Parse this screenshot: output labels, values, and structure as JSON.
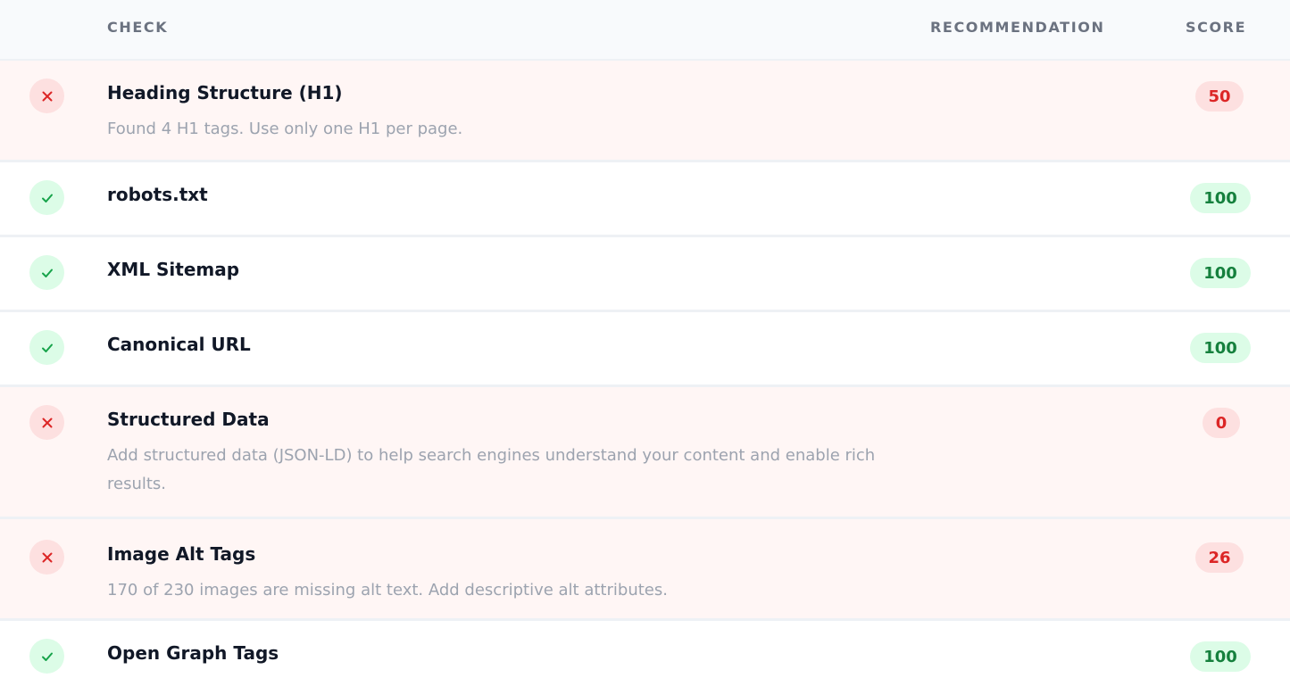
{
  "header": {
    "check": "CHECK",
    "recommendation": "RECOMMENDATION",
    "score": "SCORE"
  },
  "rows": [
    {
      "status": "fail",
      "icon": "x-icon",
      "title": "Heading Structure (H1)",
      "description": "Found 4 H1 tags. Use only one H1 per page.",
      "score": "50"
    },
    {
      "status": "pass",
      "icon": "check-icon",
      "title": "robots.txt",
      "description": "",
      "score": "100"
    },
    {
      "status": "pass",
      "icon": "check-icon",
      "title": "XML Sitemap",
      "description": "",
      "score": "100"
    },
    {
      "status": "pass",
      "icon": "check-icon",
      "title": "Canonical URL",
      "description": "",
      "score": "100"
    },
    {
      "status": "fail",
      "icon": "x-icon",
      "title": "Structured Data",
      "description": "Add structured data (JSON-LD) to help search engines understand your content and enable rich results.",
      "score": "0"
    },
    {
      "status": "fail",
      "icon": "x-icon",
      "title": "Image Alt Tags",
      "description": "170 of 230 images are missing alt text. Add descriptive alt attributes.",
      "score": "26"
    },
    {
      "status": "pass",
      "icon": "check-icon",
      "title": "Open Graph Tags",
      "description": "",
      "score": "100"
    }
  ],
  "colors": {
    "fail_text": "#dc2626",
    "fail_bg": "#fde0e0",
    "pass_text": "#15803d",
    "pass_bg": "#dcfce7"
  }
}
